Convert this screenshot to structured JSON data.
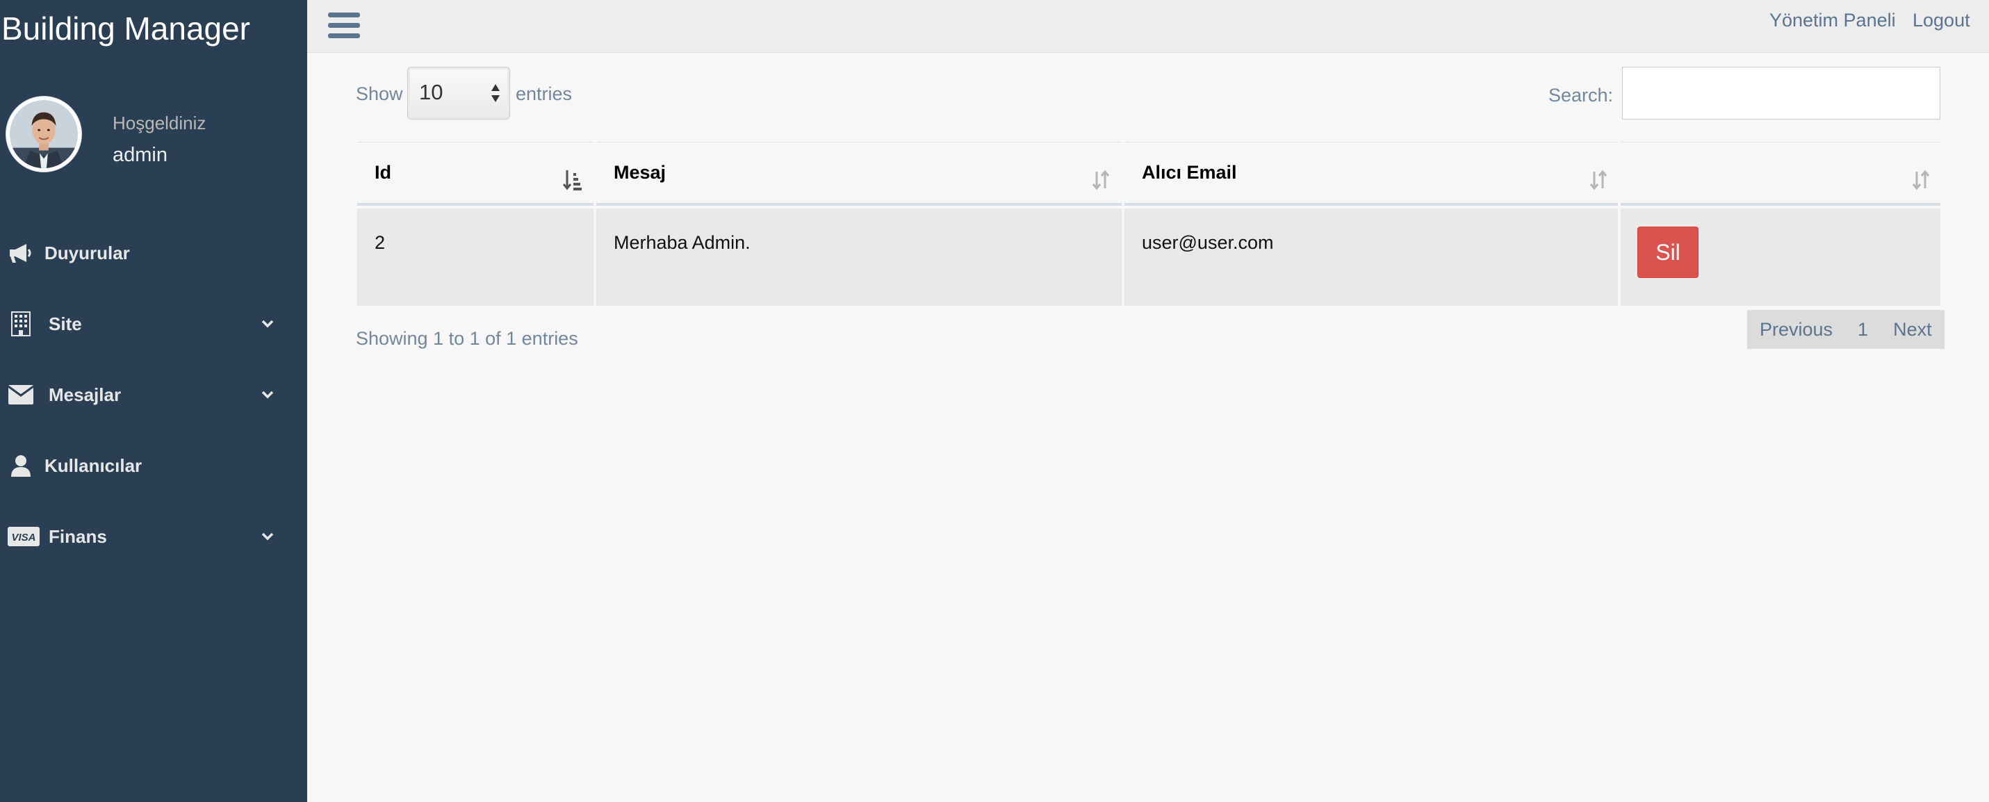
{
  "sidebar": {
    "brand": "Building Manager",
    "welcome": "Hoşgeldiniz",
    "username": "admin",
    "items": [
      {
        "label": "Duyurular",
        "icon": "bullhorn-icon",
        "has_submenu": false
      },
      {
        "label": "Site",
        "icon": "building-icon",
        "has_submenu": true
      },
      {
        "label": "Mesajlar",
        "icon": "envelope-icon",
        "has_submenu": true
      },
      {
        "label": "Kullanıcılar",
        "icon": "user-icon",
        "has_submenu": false
      },
      {
        "label": "Finans",
        "icon": "visa-card-icon",
        "has_submenu": true
      }
    ]
  },
  "topbar": {
    "panel_link": "Yönetim Paneli",
    "logout_link": "Logout"
  },
  "table_controls": {
    "show_label": "Show",
    "length_value": "10",
    "entries_label": "entries",
    "search_label": "Search:",
    "search_value": ""
  },
  "table": {
    "columns": [
      "Id",
      "Mesaj",
      "Alıcı Email",
      ""
    ],
    "rows": [
      {
        "id": "2",
        "mesaj": "Merhaba Admin.",
        "email": "user@user.com",
        "action": "Sil"
      }
    ]
  },
  "footer": {
    "info": "Showing 1 to 1 of 1 entries",
    "previous": "Previous",
    "page": "1",
    "next": "Next"
  },
  "colors": {
    "sidebar_bg": "#2a3f54",
    "delete_button": "#d9534f",
    "link": "#5a738e"
  }
}
